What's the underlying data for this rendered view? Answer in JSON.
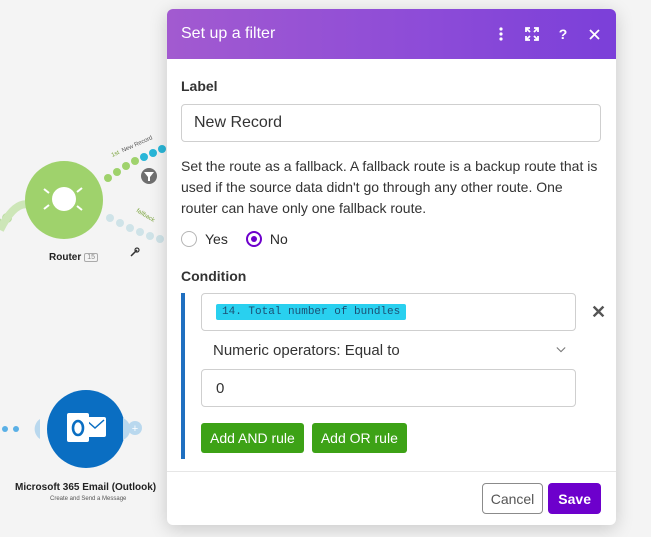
{
  "canvas": {
    "router": {
      "label": "Router",
      "badge": "15"
    },
    "routes": {
      "first_label": "1st",
      "first_name": "New Record",
      "fallback_label": "fallback"
    },
    "outlook": {
      "label": "Microsoft 365 Email (Outlook)",
      "sub": "Create and Send a Message"
    },
    "colors": {
      "router": "#9fd26c",
      "outlook": "#0a6ec2"
    }
  },
  "modal": {
    "title": "Set up a filter",
    "icons": [
      "more-icon",
      "expand-icon",
      "help-icon",
      "close-icon"
    ],
    "label_title": "Label",
    "label_value": "New Record",
    "fallback_text": "Set the route as a fallback. A fallback route is a backup route that is used if the source data didn't go through any other route. One router can have only one fallback route.",
    "radio_yes": "Yes",
    "radio_no": "No",
    "selected": "No",
    "condition_title": "Condition",
    "condition": {
      "operand": "14. Total number of bundles",
      "operator": "Numeric operators: Equal to",
      "value": "0",
      "remove": "✕"
    },
    "add_and": "Add AND rule",
    "add_or": "Add OR rule",
    "cancel": "Cancel",
    "save": "Save"
  }
}
